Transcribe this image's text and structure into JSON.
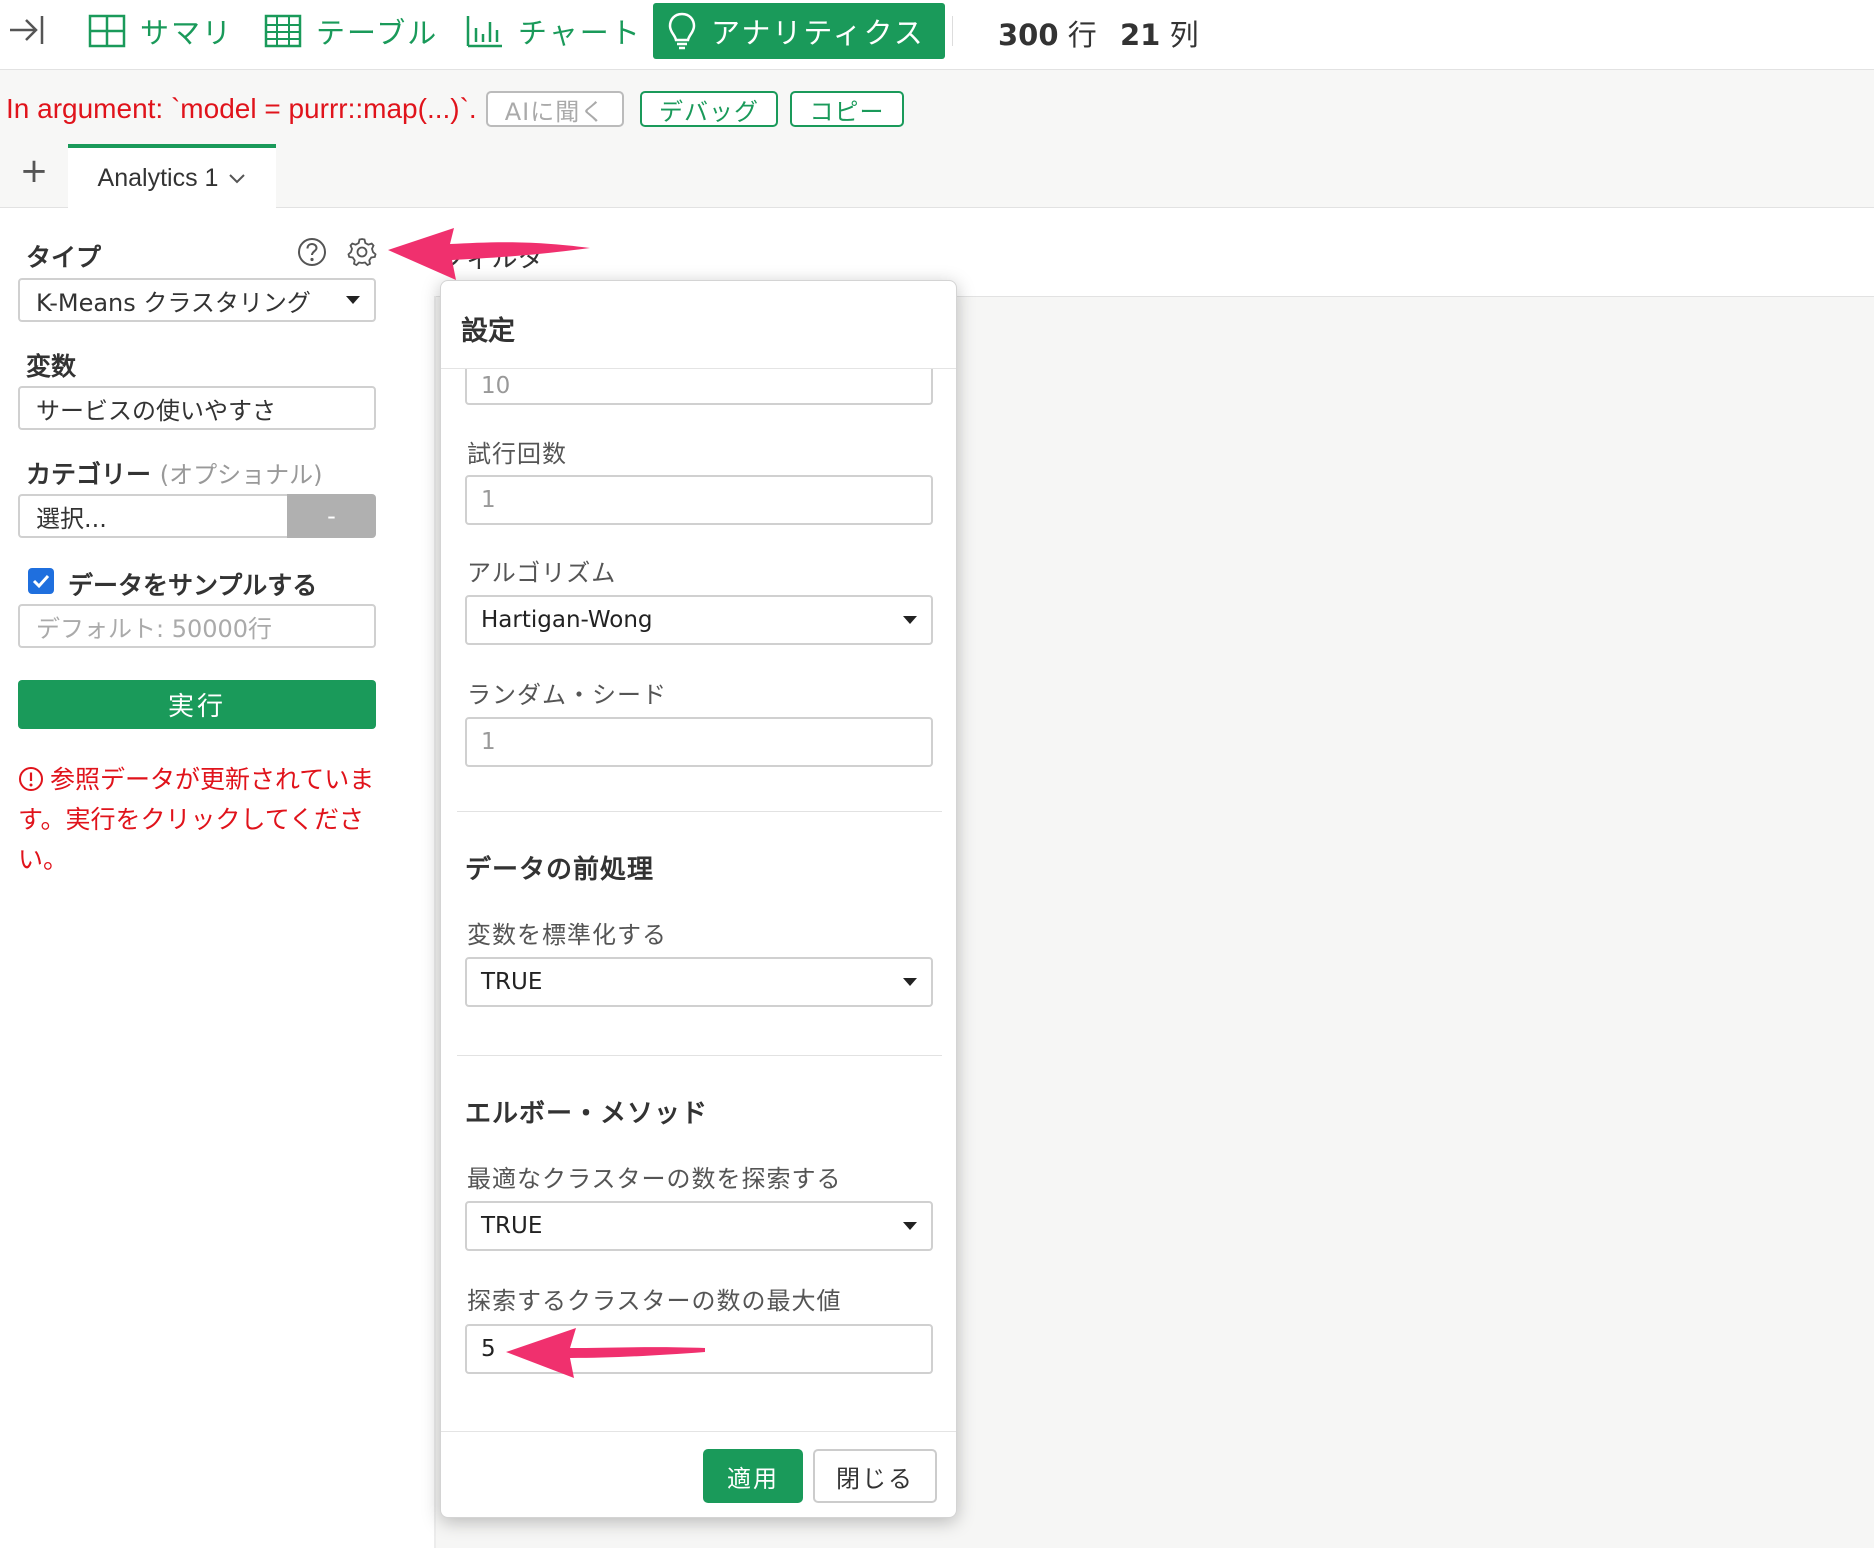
{
  "toolbar": {
    "tabs": [
      {
        "label": "サマリ",
        "icon": "grid-icon"
      },
      {
        "label": "テーブル",
        "icon": "table-icon"
      },
      {
        "label": "チャート",
        "icon": "bar-chart-icon"
      },
      {
        "label": "アナリティクス",
        "icon": "lightbulb-icon",
        "active": true
      }
    ],
    "rows_count": "300",
    "rows_unit": "行",
    "cols_count": "21",
    "cols_unit": "列"
  },
  "error_bar": {
    "message": "In argument: `model = purrr::map(...)`.",
    "ask_ai_label": "AIに聞く",
    "debug_label": "デバッグ",
    "copy_label": "コピー"
  },
  "tabs": {
    "add_label": "+",
    "active_tab": "Analytics 1"
  },
  "left_panel": {
    "type_label": "タイプ",
    "type_value": "K-Means クラスタリング",
    "variables_label": "変数",
    "variables_value": "サービスの使いやすさ",
    "category_label": "カテゴリー",
    "category_optional": "(オプショナル)",
    "category_placeholder": "選択...",
    "category_clear": "-",
    "sample_label": "データをサンプルする",
    "sample_checked": true,
    "sample_placeholder": "デフォルト: 50000行",
    "run_label": "実行",
    "warning": "参照データが更新されています。実行をクリックしてください。"
  },
  "content": {
    "filter_label": "フィルタ"
  },
  "modal": {
    "title": "設定",
    "clusters_value": "10",
    "trials_label": "試行回数",
    "trials_value": "1",
    "algorithm_label": "アルゴリズム",
    "algorithm_value": "Hartigan-Wong",
    "seed_label": "ランダム・シード",
    "seed_value": "1",
    "preprocess_heading": "データの前処理",
    "normalize_label": "変数を標準化する",
    "normalize_value": "TRUE",
    "elbow_heading": "エルボー・メソッド",
    "elbow_search_label": "最適なクラスターの数を探索する",
    "elbow_search_value": "TRUE",
    "max_clusters_label": "探索するクラスターの数の最大値",
    "max_clusters_value": "5",
    "apply_label": "適用",
    "close_label": "閉じる"
  },
  "colors": {
    "accent": "#1a9a5a",
    "error": "#e0131b",
    "arrow": "#f0306e",
    "checkbox": "#1f6fde"
  }
}
